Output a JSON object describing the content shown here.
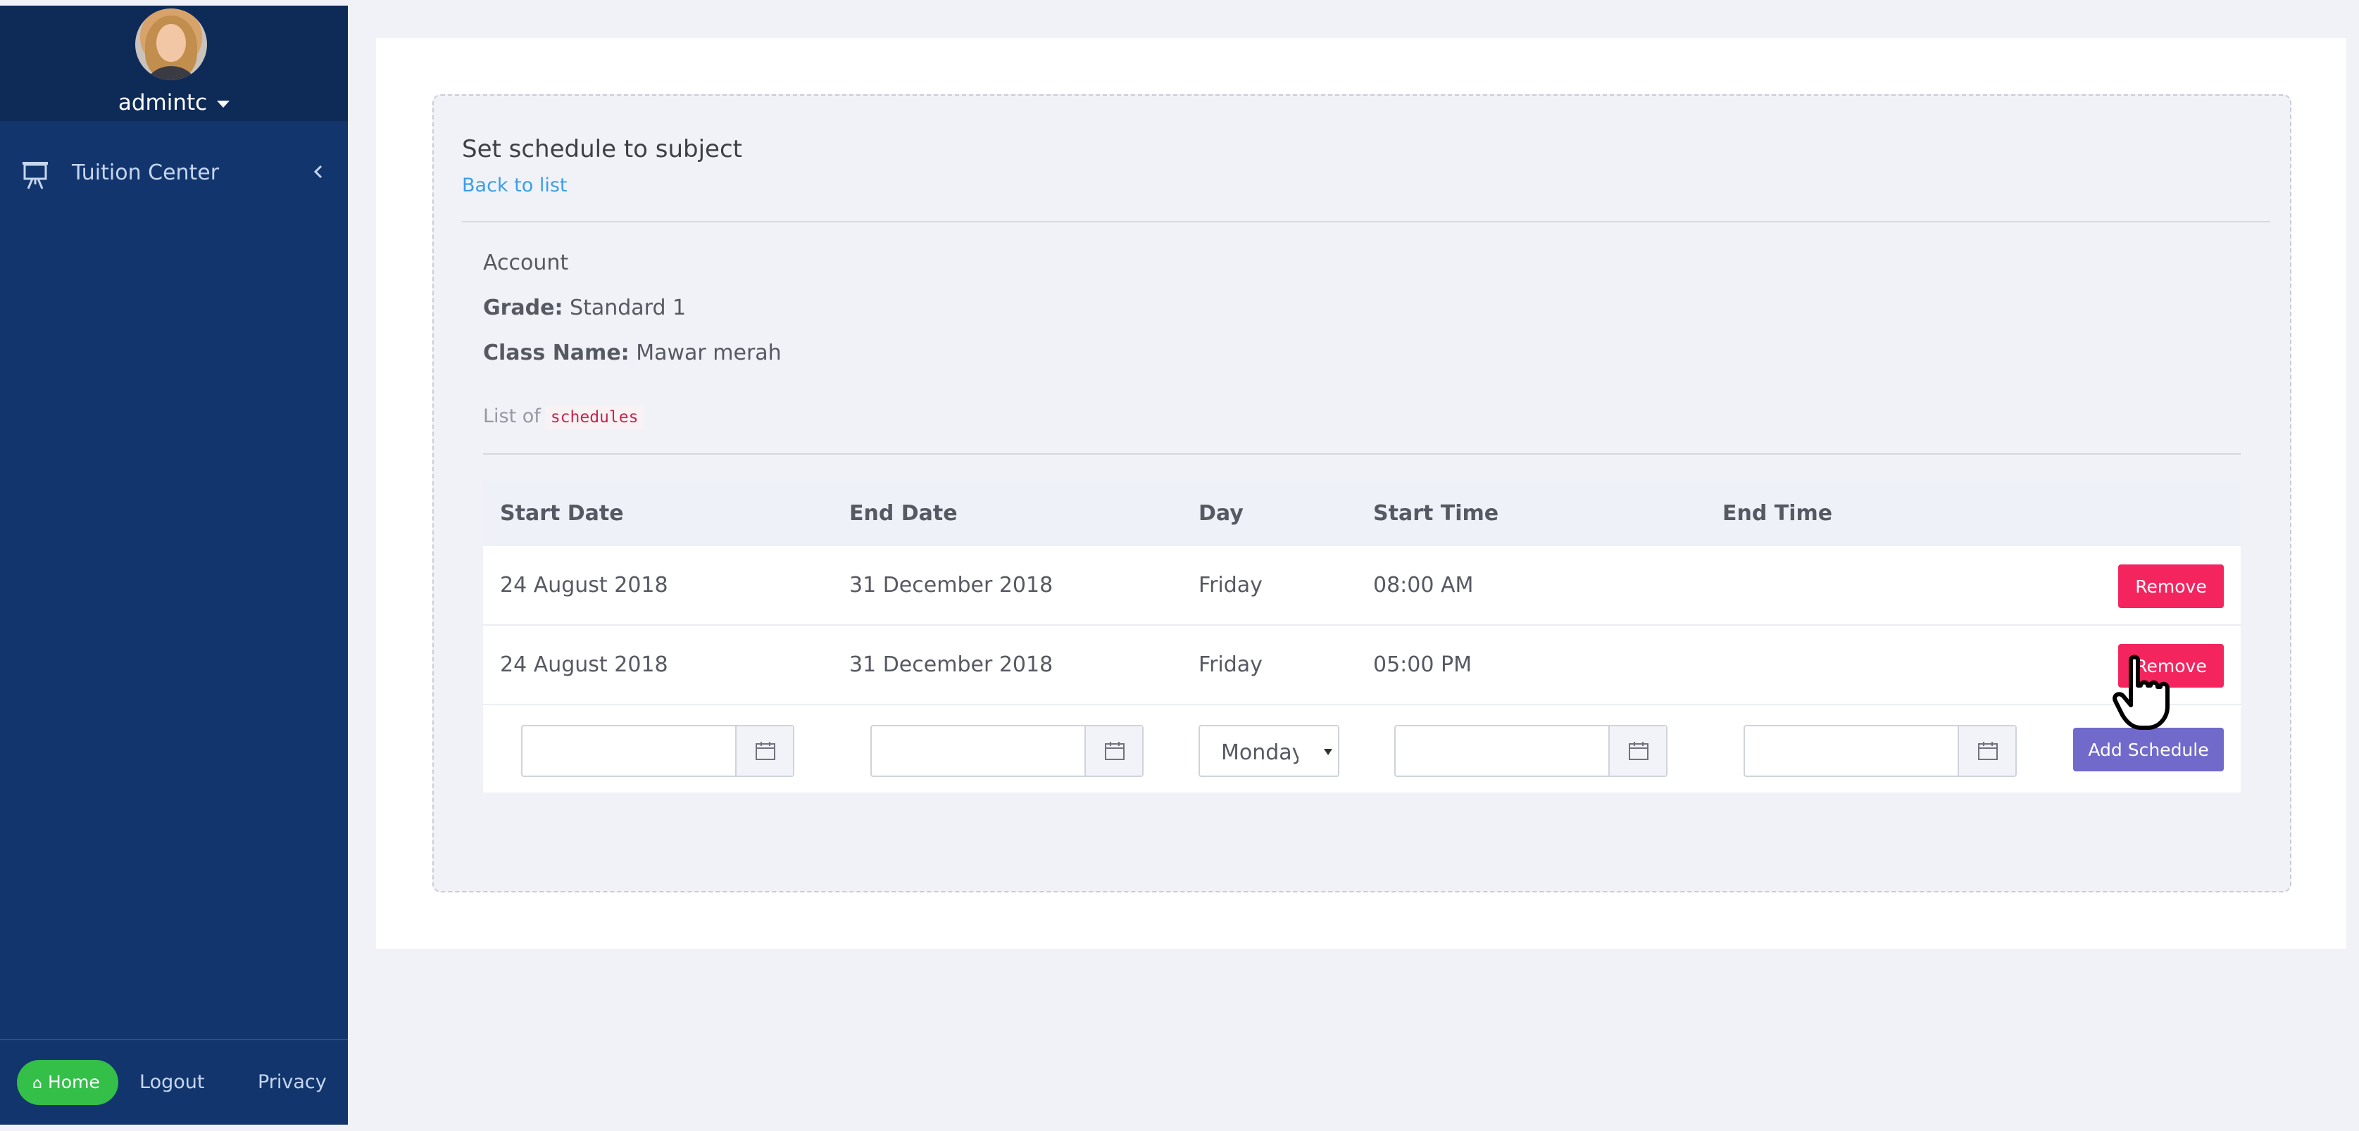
{
  "sidebar": {
    "username": "admintc",
    "nav_items": [
      {
        "label": "Tuition Center",
        "icon": "presentation-board-icon"
      }
    ],
    "footer": {
      "home_label": "Home",
      "logout_label": "Logout",
      "privacy_label": "Privacy"
    }
  },
  "page": {
    "title": "Set schedule to subject",
    "back_link": "Back to list",
    "account_heading": "Account",
    "grade_label": "Grade:",
    "grade_value": "Standard 1",
    "class_label": "Class Name:",
    "class_value": "Mawar merah",
    "list_prefix": "List of",
    "list_code": "schedules"
  },
  "table": {
    "headers": [
      "Start Date",
      "End Date",
      "Day",
      "Start Time",
      "End Time"
    ],
    "rows": [
      {
        "start_date": "24 August 2018",
        "end_date": "31 December 2018",
        "day": "Friday",
        "start_time": "08:00 AM",
        "end_time": "",
        "action": "Remove"
      },
      {
        "start_date": "24 August 2018",
        "end_date": "31 December 2018",
        "day": "Friday",
        "start_time": "05:00 PM",
        "end_time": "",
        "action": "Remove"
      }
    ],
    "new_row": {
      "start_date": "",
      "end_date": "",
      "day_selected": "Monday",
      "start_time": "",
      "end_time": "",
      "add_label": "Add Schedule"
    }
  },
  "colors": {
    "sidebar_bg": "#12356d",
    "remove_button": "#f4245f",
    "add_button": "#716aca",
    "home_button": "#34bf49",
    "link": "#3a9fea"
  }
}
